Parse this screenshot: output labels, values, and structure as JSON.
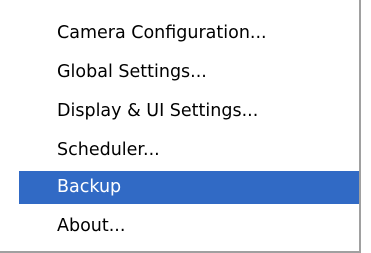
{
  "menu": {
    "items": [
      {
        "label": "Camera Configuration...",
        "selected": false
      },
      {
        "label": "Global Settings...",
        "selected": false
      },
      {
        "label": "Display & UI Settings...",
        "selected": false
      },
      {
        "label": "Scheduler...",
        "selected": false
      },
      {
        "label": "Backup",
        "selected": true
      },
      {
        "label": "About...",
        "selected": false
      }
    ],
    "highlight_color": "#316ac5",
    "highlight_text_color": "#ffffff",
    "text_color": "#000000"
  }
}
